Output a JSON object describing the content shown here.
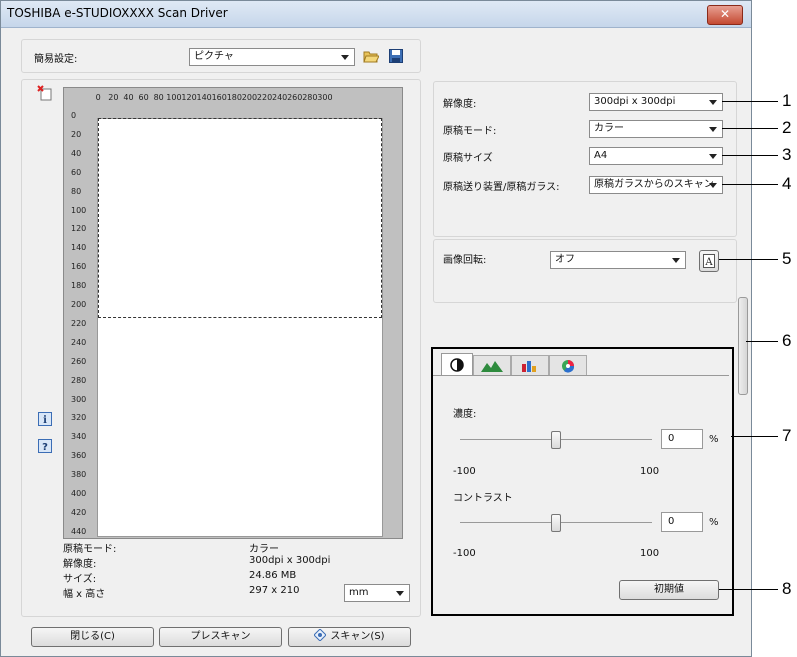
{
  "window": {
    "title": "TOSHIBA e-STUDIOXXXX Scan Driver",
    "close_label": "✕"
  },
  "easy_setting": {
    "label": "簡易設定:",
    "value": "ピクチャ"
  },
  "ruler": {
    "x_ticks": [
      "0",
      "20",
      "40",
      "60",
      "80",
      "100",
      "120",
      "140",
      "160",
      "180",
      "200",
      "220",
      "240",
      "260",
      "280",
      "300"
    ],
    "y_ticks": [
      "0",
      "20",
      "40",
      "60",
      "80",
      "100",
      "120",
      "140",
      "160",
      "180",
      "200",
      "220",
      "240",
      "260",
      "280",
      "300",
      "320",
      "340",
      "360",
      "380",
      "400",
      "420",
      "440"
    ]
  },
  "info": {
    "mode_label": "原稿モード:",
    "mode_value": "カラー",
    "res_label": "解像度:",
    "res_value": "300dpi x 300dpi",
    "size_label": "サイズ:",
    "size_value": "24.86 MB",
    "wh_label": "幅 x 高さ",
    "wh_value": "297 x 210",
    "unit": "mm"
  },
  "bottom_buttons": {
    "close": "閉じる(C)",
    "prescan": "プレスキャン",
    "scan": "スキャン(S)"
  },
  "settings": {
    "resolution_label": "解像度:",
    "resolution_value": "300dpi x 300dpi",
    "mode_label": "原稿モード:",
    "mode_value": "カラー",
    "size_label": "原稿サイズ",
    "size_value": "A4",
    "feeder_label": "原稿送り装置/原稿ガラス:",
    "feeder_value": "原稿ガラスからのスキャン"
  },
  "rotation": {
    "label": "画像回転:",
    "value": "オフ"
  },
  "adjust": {
    "density_label": "濃度:",
    "density_value": "0",
    "density_unit": "%",
    "density_min": "-100",
    "density_max": "100",
    "density_level": 0,
    "contrast_label": "コントラスト",
    "contrast_value": "0",
    "contrast_unit": "%",
    "contrast_min": "-100",
    "contrast_max": "100",
    "contrast_level": 0,
    "default_button": "初期値"
  },
  "callouts": [
    "1",
    "2",
    "3",
    "4",
    "5",
    "6",
    "7",
    "8"
  ],
  "colors": {
    "accent_red": "#c44a32",
    "outline": "#000000",
    "paper": "#ffffff",
    "ruler_bg": "#c0c0c0"
  }
}
